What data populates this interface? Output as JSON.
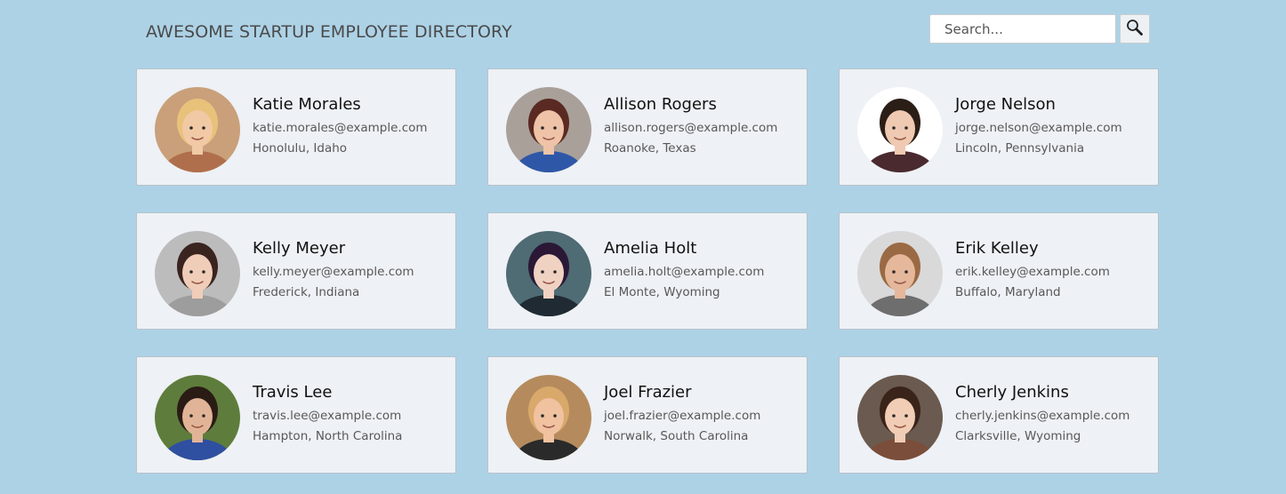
{
  "header": {
    "title": "AWESOME STARTUP EMPLOYEE DIRECTORY"
  },
  "search": {
    "placeholder": "Search...",
    "value": "",
    "button_icon": "search-icon"
  },
  "employees": [
    {
      "name": "Katie Morales",
      "email": "katie.morales@example.com",
      "location": "Honolulu, Idaho",
      "photo": {
        "bg": "#c9a07a",
        "hair": "#e8c27a",
        "skin": "#f1c9a5",
        "shirt": "#b06f4c"
      }
    },
    {
      "name": "Allison Rogers",
      "email": "allison.rogers@example.com",
      "location": "Roanoke, Texas",
      "photo": {
        "bg": "#a9a09a",
        "hair": "#5a2a22",
        "skin": "#efc3a7",
        "shirt": "#2f57a8"
      }
    },
    {
      "name": "Jorge Nelson",
      "email": "jorge.nelson@example.com",
      "location": "Lincoln, Pennsylvania",
      "photo": {
        "bg": "#ffffff",
        "hair": "#2b1e17",
        "skin": "#efc9b1",
        "shirt": "#4a2a2f"
      }
    },
    {
      "name": "Kelly Meyer",
      "email": "kelly.meyer@example.com",
      "location": "Frederick, Indiana",
      "photo": {
        "bg": "#bcbcbc",
        "hair": "#3a2420",
        "skin": "#f0cdb8",
        "shirt": "#9d9d9d"
      }
    },
    {
      "name": "Amelia Holt",
      "email": "amelia.holt@example.com",
      "location": "El Monte, Wyoming",
      "photo": {
        "bg": "#4f6b73",
        "hair": "#2a1836",
        "skin": "#f0d2c3",
        "shirt": "#1f2a33"
      }
    },
    {
      "name": "Erik Kelley",
      "email": "erik.kelley@example.com",
      "location": "Buffalo, Maryland",
      "photo": {
        "bg": "#d9d9d9",
        "hair": "#9a6a44",
        "skin": "#e5b79b",
        "shirt": "#6e6e6e"
      }
    },
    {
      "name": "Travis Lee",
      "email": "travis.lee@example.com",
      "location": "Hampton, North Carolina",
      "photo": {
        "bg": "#5e7d3c",
        "hair": "#2a1c15",
        "skin": "#e2b497",
        "shirt": "#2f4fa0"
      }
    },
    {
      "name": "Joel Frazier",
      "email": "joel.frazier@example.com",
      "location": "Norwalk, South Carolina",
      "photo": {
        "bg": "#b58b5e",
        "hair": "#d9a86b",
        "skin": "#f0c2a0",
        "shirt": "#2a2a2a"
      }
    },
    {
      "name": "Cherly Jenkins",
      "email": "cherly.jenkins@example.com",
      "location": "Clarksville, Wyoming",
      "photo": {
        "bg": "#6b5a4f",
        "hair": "#3a241a",
        "skin": "#f0cdb4",
        "shirt": "#7a4e3a"
      }
    }
  ]
}
